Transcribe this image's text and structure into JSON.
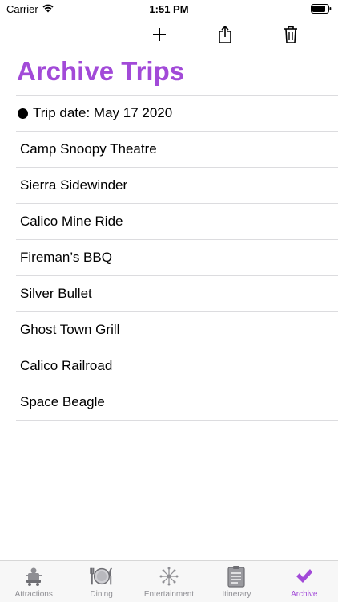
{
  "status_bar": {
    "carrier": "Carrier",
    "time": "1:51 PM"
  },
  "toolbar": {
    "add_icon": "plus-icon",
    "share_icon": "share-icon",
    "trash_icon": "trash-icon"
  },
  "title": "Archive Trips",
  "trip_header": "Trip date: May 17 2020",
  "items": [
    "Camp Snoopy Theatre",
    "Sierra Sidewinder",
    "Calico Mine Ride",
    "Fireman’s BBQ",
    "Silver Bullet",
    "Ghost Town Grill",
    "Calico Railroad",
    "Space Beagle"
  ],
  "tabs": [
    {
      "label": "Attractions",
      "icon": "attractions-icon"
    },
    {
      "label": "Dining",
      "icon": "dining-icon"
    },
    {
      "label": "Entertainment",
      "icon": "entertainment-icon"
    },
    {
      "label": "Itinerary",
      "icon": "itinerary-icon"
    },
    {
      "label": "Archive",
      "icon": "checkmark-icon",
      "active": true
    }
  ],
  "colors": {
    "accent": "#a24ad8",
    "tab_inactive": "#8e8e93",
    "separator": "#dcdcdf"
  }
}
